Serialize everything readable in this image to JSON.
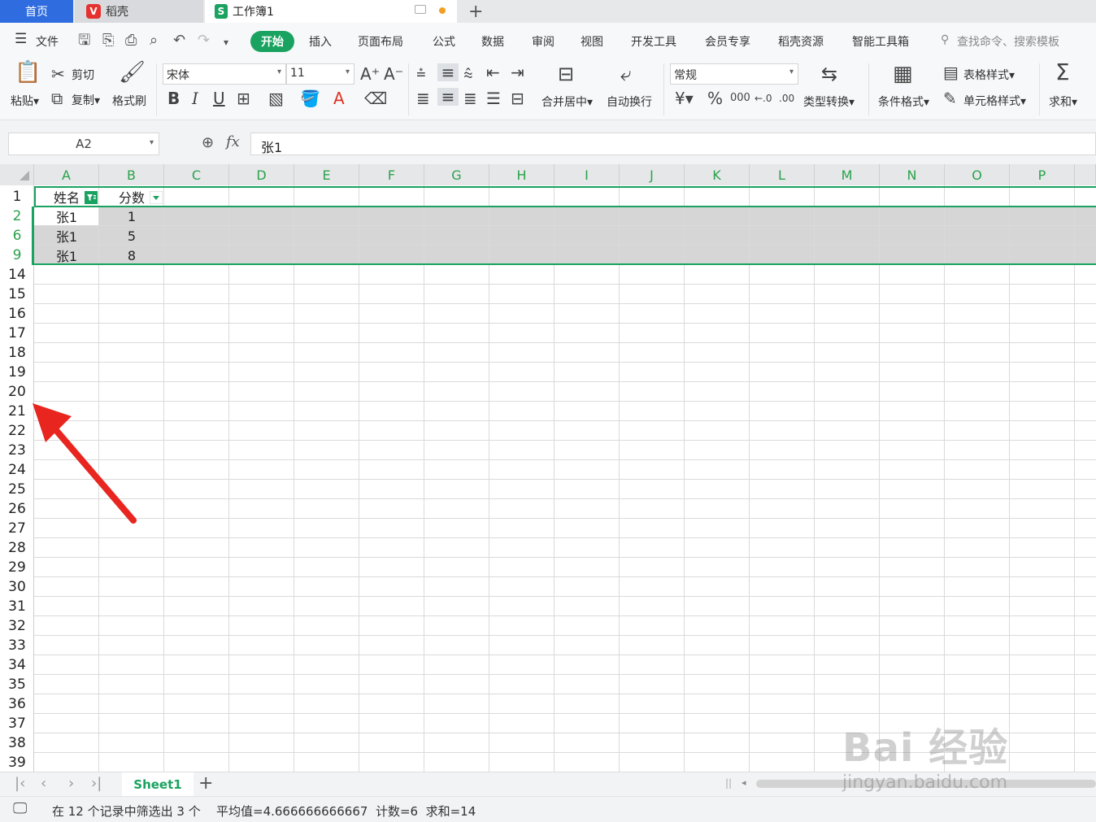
{
  "tabs": {
    "home": "首页",
    "daoke": "稻壳",
    "workbook": "工作簿1",
    "new_tab": "+"
  },
  "menu": {
    "file": "文件",
    "start": "开始",
    "items": [
      "插入",
      "页面布局",
      "公式",
      "数据",
      "审阅",
      "视图",
      "开发工具",
      "会员专享",
      "稻壳资源",
      "智能工具箱"
    ],
    "search": "查找命令、搜索模板"
  },
  "ribbon": {
    "paste": "粘贴",
    "cut": "剪切",
    "copy": "复制",
    "format_painter": "格式刷",
    "font_name": "宋体",
    "font_size": "11",
    "merge_center": "合并居中",
    "wrap_text": "自动换行",
    "number_format": "常规",
    "type_convert": "类型转换",
    "cond_format": "条件格式",
    "table_style": "表格样式",
    "cell_style": "单元格样式",
    "sum": "求和"
  },
  "formula_bar": {
    "name_box": "A2",
    "fx": "fx",
    "value": "张1"
  },
  "grid": {
    "columns": [
      "A",
      "B",
      "C",
      "D",
      "E",
      "F",
      "G",
      "H",
      "I",
      "J",
      "K",
      "L",
      "M",
      "N",
      "O",
      "P"
    ],
    "row_numbers": [
      "1",
      "2",
      "6",
      "9",
      "14",
      "15",
      "16",
      "17",
      "18",
      "19",
      "20",
      "21",
      "22",
      "23",
      "24",
      "25",
      "26",
      "27",
      "28",
      "29",
      "30",
      "31",
      "32",
      "33",
      "34",
      "35",
      "36",
      "37",
      "38",
      "39"
    ],
    "header_row": [
      "姓名",
      "分数"
    ],
    "rows": [
      [
        "张1",
        "1"
      ],
      [
        "张1",
        "5"
      ],
      [
        "张1",
        "8"
      ]
    ]
  },
  "sheets": {
    "active": "Sheet1",
    "add": "+"
  },
  "status": {
    "filter_info": "在 12 个记录中筛选出 3 个",
    "stats": "平均值=4.666666666667  计数=6  求和=14"
  },
  "watermark": {
    "brand": "Bai 经验",
    "url": "jingyan.baidu.com"
  },
  "colors": {
    "accent_green": "#1aa260",
    "tab_blue": "#2e6ce0",
    "arrow_red": "#e8261f",
    "selection_fill": "#d6d6d6"
  }
}
